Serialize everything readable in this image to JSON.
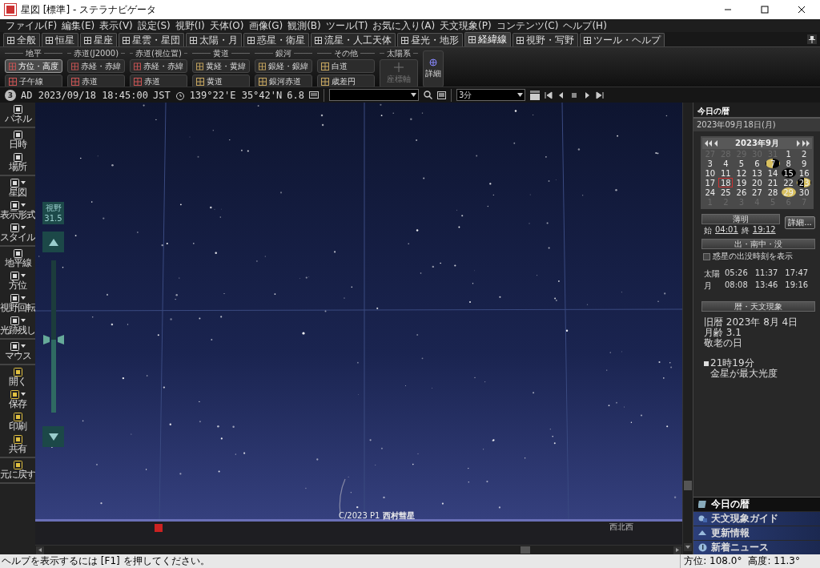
{
  "window": {
    "title": "星図 [標準] - ステラナビゲータ"
  },
  "menu": [
    "ファイル(F)",
    "編集(E)",
    "表示(V)",
    "設定(S)",
    "視野(I)",
    "天体(O)",
    "画像(G)",
    "観測(B)",
    "ツール(T)",
    "お気に入り(A)",
    "天文現象(P)",
    "コンテンツ(C)",
    "ヘルプ(H)"
  ],
  "tabs": [
    {
      "label": "全般",
      "selected": false
    },
    {
      "label": "恒星",
      "selected": false
    },
    {
      "label": "星座",
      "selected": false
    },
    {
      "label": "星雲・星団",
      "selected": false
    },
    {
      "label": "太陽・月",
      "selected": false
    },
    {
      "label": "惑星・衛星",
      "selected": false
    },
    {
      "label": "流星・人工天体",
      "selected": false
    },
    {
      "label": "昼光・地形",
      "selected": false
    },
    {
      "label": "経緯線",
      "selected": true
    },
    {
      "label": "視野・写野",
      "selected": false
    },
    {
      "label": "ツール・ヘルプ",
      "selected": false
    }
  ],
  "ribbon": {
    "groups": [
      {
        "title": "地平",
        "buttons": [
          {
            "label": "方位・高度",
            "selected": true,
            "disabled": false
          },
          {
            "label": "子午線",
            "selected": false,
            "disabled": false
          }
        ]
      },
      {
        "title": "赤道(J2000)",
        "buttons": [
          {
            "label": "赤経・赤緯",
            "selected": false,
            "disabled": false
          },
          {
            "label": "赤道",
            "selected": false,
            "disabled": false
          }
        ]
      },
      {
        "title": "赤道(視位置)",
        "buttons": [
          {
            "label": "赤経・赤緯",
            "selected": false,
            "disabled": false
          },
          {
            "label": "赤道",
            "selected": false,
            "disabled": false
          }
        ]
      },
      {
        "title": "黄道",
        "buttons": [
          {
            "label": "黄経・黄緯",
            "selected": false,
            "disabled": false
          },
          {
            "label": "黄道",
            "selected": false,
            "disabled": false
          }
        ]
      },
      {
        "title": "銀河",
        "buttons": [
          {
            "label": "銀経・銀緯",
            "selected": false,
            "disabled": false
          },
          {
            "label": "銀河赤道",
            "selected": false,
            "disabled": false
          }
        ]
      },
      {
        "title": "その他",
        "buttons": [
          {
            "label": "白道",
            "selected": false,
            "disabled": false
          },
          {
            "label": "歳差円",
            "selected": false,
            "disabled": false
          }
        ]
      },
      {
        "title": "太陽系",
        "buttons": [
          {
            "label": "座標軸",
            "selected": false,
            "disabled": true
          }
        ]
      }
    ],
    "detail_button": "詳細"
  },
  "info_bar": {
    "badge": "3",
    "datetime": "AD 2023/09/18 18:45:00",
    "timezone": "JST",
    "position": "139°22'E 35°42'N",
    "magnitude": "6.8",
    "step": "3分"
  },
  "left_toolbar": {
    "sections": [
      [
        {
          "label": "パネル",
          "dropdown": false
        }
      ],
      [
        {
          "label": "日時",
          "dropdown": false
        },
        {
          "label": "場所",
          "dropdown": false
        }
      ],
      [
        {
          "label": "星図",
          "dropdown": true
        },
        {
          "label": "表示形式",
          "dropdown": true
        },
        {
          "label": "スタイル",
          "dropdown": true
        }
      ],
      [
        {
          "label": "地平線",
          "dropdown": false
        },
        {
          "label": "方位",
          "dropdown": true
        },
        {
          "label": "視野回転",
          "dropdown": true
        },
        {
          "label": "光跡残し",
          "dropdown": true
        }
      ],
      [
        {
          "label": "マウス",
          "dropdown": true
        }
      ],
      [
        {
          "label": "開く",
          "dropdown": false
        },
        {
          "label": "保存",
          "dropdown": true
        },
        {
          "label": "印刷",
          "dropdown": false
        },
        {
          "label": "共有",
          "dropdown": false
        }
      ],
      [
        {
          "label": "元に戻す",
          "dropdown": false
        }
      ]
    ]
  },
  "fov": {
    "label": "視野",
    "value": "31.5",
    "level": 0.48
  },
  "sky": {
    "comet_label": "C/2023 P1 **西村彗星**",
    "direction": "西北西"
  },
  "side_panel": {
    "title": "今日の暦",
    "date": "2023年09月18日(月)",
    "calendar": {
      "month": "2023年9月",
      "days": [
        {
          "day": "27",
          "in_month": false,
          "selected": false,
          "kind": "day"
        },
        {
          "day": "28",
          "in_month": false,
          "selected": false,
          "kind": "day"
        },
        {
          "day": "29",
          "in_month": false,
          "selected": false,
          "kind": "day"
        },
        {
          "day": "30",
          "in_month": false,
          "selected": false,
          "kind": "day"
        },
        {
          "day": "31",
          "in_month": false,
          "selected": false,
          "kind": "day"
        },
        {
          "day": "1",
          "in_month": true,
          "selected": false,
          "kind": "day"
        },
        {
          "day": "2",
          "in_month": true,
          "selected": false,
          "kind": "day"
        },
        {
          "day": "3",
          "in_month": true,
          "selected": false,
          "kind": "day"
        },
        {
          "day": "4",
          "in_month": true,
          "selected": false,
          "kind": "day"
        },
        {
          "day": "5",
          "in_month": true,
          "selected": false,
          "kind": "day"
        },
        {
          "day": "6",
          "in_month": true,
          "selected": false,
          "kind": "day"
        },
        {
          "day": "7",
          "in_month": true,
          "selected": false,
          "kind": "last_quarter"
        },
        {
          "day": "8",
          "in_month": true,
          "selected": false,
          "kind": "day"
        },
        {
          "day": "9",
          "in_month": true,
          "selected": false,
          "kind": "day"
        },
        {
          "day": "10",
          "in_month": true,
          "selected": false,
          "kind": "day"
        },
        {
          "day": "11",
          "in_month": true,
          "selected": false,
          "kind": "day"
        },
        {
          "day": "12",
          "in_month": true,
          "selected": false,
          "kind": "day"
        },
        {
          "day": "13",
          "in_month": true,
          "selected": false,
          "kind": "day"
        },
        {
          "day": "14",
          "in_month": true,
          "selected": false,
          "kind": "day"
        },
        {
          "day": "15",
          "in_month": true,
          "selected": false,
          "kind": "new_moon"
        },
        {
          "day": "16",
          "in_month": true,
          "selected": false,
          "kind": "day"
        },
        {
          "day": "17",
          "in_month": true,
          "selected": false,
          "kind": "day"
        },
        {
          "day": "18",
          "in_month": true,
          "selected": true,
          "kind": "day"
        },
        {
          "day": "19",
          "in_month": true,
          "selected": false,
          "kind": "day"
        },
        {
          "day": "20",
          "in_month": true,
          "selected": false,
          "kind": "day"
        },
        {
          "day": "21",
          "in_month": true,
          "selected": false,
          "kind": "day"
        },
        {
          "day": "22",
          "in_month": true,
          "selected": false,
          "kind": "day"
        },
        {
          "day": "23",
          "in_month": true,
          "selected": false,
          "kind": "first_quarter"
        },
        {
          "day": "24",
          "in_month": true,
          "selected": false,
          "kind": "day"
        },
        {
          "day": "25",
          "in_month": true,
          "selected": false,
          "kind": "day"
        },
        {
          "day": "26",
          "in_month": true,
          "selected": false,
          "kind": "day"
        },
        {
          "day": "27",
          "in_month": true,
          "selected": false,
          "kind": "day"
        },
        {
          "day": "28",
          "in_month": true,
          "selected": false,
          "kind": "day"
        },
        {
          "day": "29",
          "in_month": true,
          "selected": false,
          "kind": "full_moon"
        },
        {
          "day": "30",
          "in_month": true,
          "selected": false,
          "kind": "day"
        },
        {
          "day": "1",
          "in_month": false,
          "selected": false,
          "kind": "day"
        },
        {
          "day": "2",
          "in_month": false,
          "selected": false,
          "kind": "day"
        },
        {
          "day": "3",
          "in_month": false,
          "selected": false,
          "kind": "day"
        },
        {
          "day": "4",
          "in_month": false,
          "selected": false,
          "kind": "day"
        },
        {
          "day": "5",
          "in_month": false,
          "selected": false,
          "kind": "day"
        },
        {
          "day": "6",
          "in_month": false,
          "selected": false,
          "kind": "day"
        },
        {
          "day": "7",
          "in_month": false,
          "selected": false,
          "kind": "day"
        }
      ]
    },
    "twilight": {
      "title": "薄明",
      "start_label": "始",
      "start": "04:01",
      "end_label": "終",
      "end": "19:12",
      "detail_button": "詳細..."
    },
    "rise_set": {
      "title": "出・南中・没",
      "checkbox": {
        "label": "惑星の出没時刻を表示",
        "checked": false
      },
      "rows": [
        {
          "name": "太陽",
          "rise": "05:26",
          "transit": "11:37",
          "set": "17:47"
        },
        {
          "name": "月",
          "rise": "08:08",
          "transit": "13:46",
          "set": "19:16"
        }
      ]
    },
    "almanac": {
      "title": "暦・天文現象",
      "lines": [
        "旧暦 2023年 8月 4日",
        "月齢 3.1",
        "敬老の日"
      ],
      "events": [
        {
          "time": "21時19分",
          "text": "金星が最大光度"
        }
      ]
    },
    "nav": [
      {
        "label": "今日の暦",
        "selected": true
      },
      {
        "label": "天文現象ガイド",
        "selected": false
      },
      {
        "label": "更新情報",
        "selected": false
      },
      {
        "label": "新着ニュース",
        "selected": false
      }
    ]
  },
  "status_bar": {
    "help": "ヘルプを表示するには [F1] を押してください。",
    "azimuth": "方位: 108.0°",
    "altitude": "高度: 11.3°"
  }
}
